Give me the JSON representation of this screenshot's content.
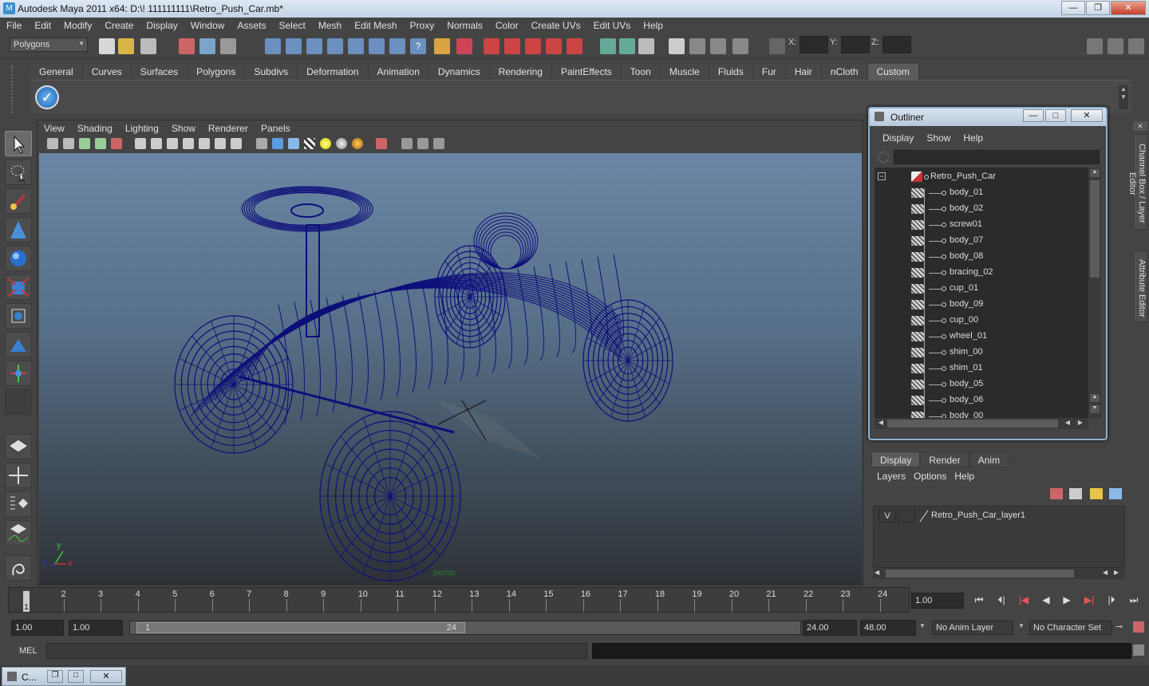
{
  "app": {
    "title": "Autodesk Maya 2011 x64: D:\\! 111111111\\Retro_Push_Car.mb*",
    "icon": "maya-icon",
    "window_buttons": {
      "min": "—",
      "max": "❐",
      "close": "✕"
    }
  },
  "menubar": [
    "File",
    "Edit",
    "Modify",
    "Create",
    "Display",
    "Window",
    "Assets",
    "Select",
    "Mesh",
    "Edit Mesh",
    "Proxy",
    "Normals",
    "Color",
    "Create UVs",
    "Edit UVs",
    "Help"
  ],
  "status_line": {
    "mode_selector": "Polygons",
    "x_label": "X:",
    "y_label": "Y:",
    "z_label": "Z:"
  },
  "shelf": {
    "tabs": [
      "General",
      "Curves",
      "Surfaces",
      "Polygons",
      "Subdivs",
      "Deformation",
      "Animation",
      "Dynamics",
      "Rendering",
      "PaintEffects",
      "Toon",
      "Muscle",
      "Fluids",
      "Fur",
      "Hair",
      "nCloth",
      "Custom"
    ],
    "active_tab": "Custom"
  },
  "viewport": {
    "menu": [
      "View",
      "Shading",
      "Lighting",
      "Show",
      "Renderer",
      "Panels"
    ],
    "camera_label": "persp",
    "axis_x": "x",
    "axis_y": "y",
    "axis_z": "z",
    "wire_color": "#0d0f7a"
  },
  "outliner": {
    "title": "Outliner",
    "menu": [
      "Display",
      "Show",
      "Help"
    ],
    "root": "Retro_Push_Car",
    "items": [
      "body_01",
      "body_02",
      "screw01",
      "body_07",
      "body_08",
      "bracing_02",
      "cup_01",
      "body_09",
      "cup_00",
      "wheel_01",
      "shim_00",
      "shim_01",
      "body_05",
      "body_06",
      "body_00"
    ]
  },
  "layer_editor": {
    "tabs": [
      "Display",
      "Render",
      "Anim"
    ],
    "active_tab": "Display",
    "menu": [
      "Layers",
      "Options",
      "Help"
    ],
    "layers": [
      {
        "visible": "V",
        "name": "Retro_Push_Car_layer1"
      }
    ]
  },
  "side_tabs": [
    "Channel Box / Layer Editor",
    "Attribute Editor"
  ],
  "time_slider": {
    "ticks": [
      "1",
      "2",
      "3",
      "4",
      "5",
      "6",
      "7",
      "8",
      "9",
      "10",
      "11",
      "12",
      "13",
      "14",
      "15",
      "16",
      "17",
      "18",
      "19",
      "20",
      "21",
      "22",
      "23",
      "24"
    ],
    "current_frame": "1",
    "current_time_field": "1.00"
  },
  "range_slider": {
    "start_time": "1.00",
    "playback_start": "1.00",
    "range_start_label": "1",
    "range_end_label": "24",
    "playback_end": "24.00",
    "end_time": "48.00",
    "anim_layer": "No Anim Layer",
    "character_set": "No Character Set"
  },
  "command_line": {
    "label": "MEL"
  },
  "taskbar": {
    "item": "C..."
  }
}
